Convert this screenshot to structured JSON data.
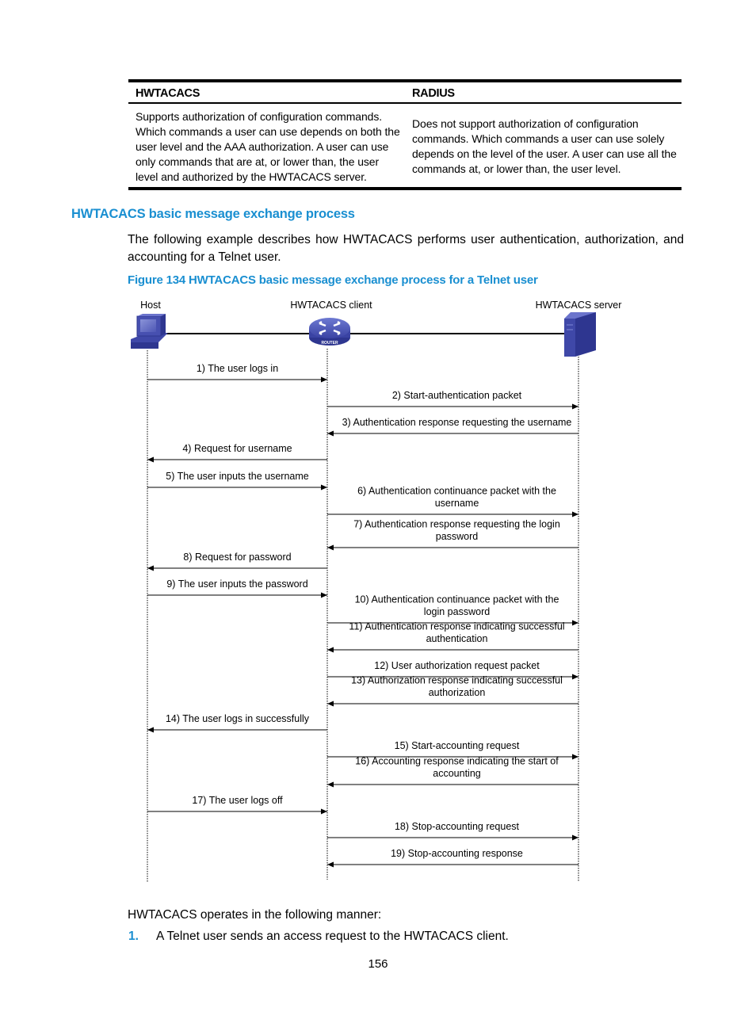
{
  "table": {
    "headers": [
      "HWTACACS",
      "RADIUS"
    ],
    "rows": [
      [
        [
          "Supports authorization of configuration commands.",
          "Which commands a user can use depends on both the",
          "user level and the AAA authorization. A user can use",
          "only commands that are at, or lower than, the user",
          "level and authorized by the HWTACACS server."
        ],
        [
          "Does not support authorization of configuration",
          "commands. Which commands a user can use solely",
          "depends on the level of the user. A user can use all the",
          "commands at, or lower than, the user level."
        ]
      ]
    ]
  },
  "section": {
    "title": "HWTACACS basic message exchange process",
    "intro": "The following example describes how HWTACACS performs user authentication, authorization, and accounting for a Telnet user.",
    "figure_caption": "Figure 134 HWTACACS basic message exchange process for a Telnet user"
  },
  "diagram": {
    "nodes": [
      {
        "id": "host",
        "label": "Host",
        "icon": "host-computer-icon"
      },
      {
        "id": "client",
        "label": "HWTACACS client",
        "icon": "router-icon",
        "icon_text": "ROUTER"
      },
      {
        "id": "server",
        "label": "HWTACACS server",
        "icon": "server-tower-icon"
      }
    ],
    "messages": [
      {
        "from": "host",
        "to": "client",
        "lines": [
          "1) The user logs in"
        ]
      },
      {
        "from": "client",
        "to": "server",
        "lines": [
          "2) Start-authentication packet"
        ]
      },
      {
        "from": "server",
        "to": "client",
        "lines": [
          "3) Authentication response requesting the username"
        ]
      },
      {
        "from": "client",
        "to": "host",
        "lines": [
          "4) Request for username"
        ]
      },
      {
        "from": "host",
        "to": "client",
        "lines": [
          "5) The user inputs the username"
        ]
      },
      {
        "from": "client",
        "to": "server",
        "lines": [
          "6) Authentication continuance packet with the",
          "username"
        ]
      },
      {
        "from": "server",
        "to": "client",
        "lines": [
          "7) Authentication response requesting the login",
          "password"
        ]
      },
      {
        "from": "client",
        "to": "host",
        "lines": [
          "8) Request for password"
        ]
      },
      {
        "from": "host",
        "to": "client",
        "lines": [
          "9) The user inputs the password"
        ]
      },
      {
        "from": "client",
        "to": "server",
        "lines": [
          "10) Authentication continuance packet with the",
          "login password"
        ]
      },
      {
        "from": "server",
        "to": "client",
        "lines": [
          "11) Authentication response indicating successful",
          "authentication"
        ]
      },
      {
        "from": "client",
        "to": "server",
        "lines": [
          "12) User authorization request packet"
        ]
      },
      {
        "from": "server",
        "to": "client",
        "lines": [
          "13) Authorization response indicating successful",
          "authorization"
        ]
      },
      {
        "from": "client",
        "to": "host",
        "lines": [
          "14) The user logs in successfully"
        ]
      },
      {
        "from": "client",
        "to": "server",
        "lines": [
          "15) Start-accounting request"
        ]
      },
      {
        "from": "server",
        "to": "client",
        "lines": [
          "16) Accounting response indicating the start of",
          "accounting"
        ]
      },
      {
        "from": "host",
        "to": "client",
        "lines": [
          "17) The user logs off"
        ]
      },
      {
        "from": "client",
        "to": "server",
        "lines": [
          "18) Stop-accounting request"
        ]
      },
      {
        "from": "server",
        "to": "client",
        "lines": [
          "19) Stop-accounting response"
        ]
      }
    ]
  },
  "after": {
    "text": "HWTACACS operates in the following manner:",
    "list": [
      {
        "num": "1.",
        "text": "A Telnet user sends an access request to the HWTACACS client."
      }
    ]
  },
  "page_number": "156",
  "colors": {
    "accent": "#1a8fd1",
    "device_blue": "#3f48a8"
  }
}
